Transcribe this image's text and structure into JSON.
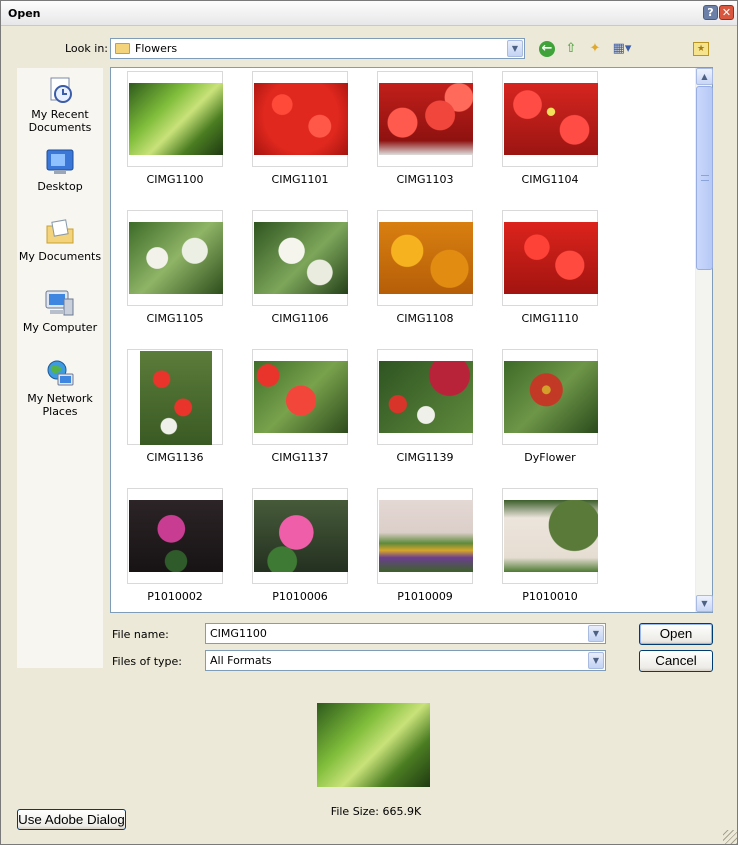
{
  "window": {
    "title": "Open"
  },
  "toolbar": {
    "look_in_label": "Look in:",
    "look_in_value": "Flowers"
  },
  "places": [
    {
      "label": "My Recent Documents",
      "icon": "recent-documents-icon"
    },
    {
      "label": "Desktop",
      "icon": "desktop-icon"
    },
    {
      "label": "My Documents",
      "icon": "my-documents-icon"
    },
    {
      "label": "My Computer",
      "icon": "my-computer-icon"
    },
    {
      "label": "My Network Places",
      "icon": "network-places-icon"
    }
  ],
  "files": [
    {
      "name": "CIMG1100"
    },
    {
      "name": "CIMG1101"
    },
    {
      "name": "CIMG1103"
    },
    {
      "name": "CIMG1104"
    },
    {
      "name": "CIMG1105"
    },
    {
      "name": "CIMG1106"
    },
    {
      "name": "CIMG1108"
    },
    {
      "name": "CIMG1110"
    },
    {
      "name": "CIMG1136"
    },
    {
      "name": "CIMG1137"
    },
    {
      "name": "CIMG1139"
    },
    {
      "name": "DyFlower"
    },
    {
      "name": "P1010002"
    },
    {
      "name": "P1010006"
    },
    {
      "name": "P1010009"
    },
    {
      "name": "P1010010"
    }
  ],
  "form": {
    "file_name_label": "File name:",
    "file_name_value": "CIMG1100",
    "file_type_label": "Files of type:",
    "file_type_value": "All Formats"
  },
  "buttons": {
    "open": "Open",
    "cancel": "Cancel",
    "adobe": "Use Adobe Dialog"
  },
  "preview": {
    "file_size": "File Size: 665.9K"
  },
  "colors": {
    "window_bg": "#ece9d8",
    "pane_border": "#7f9db9",
    "button_border": "#003c74"
  }
}
